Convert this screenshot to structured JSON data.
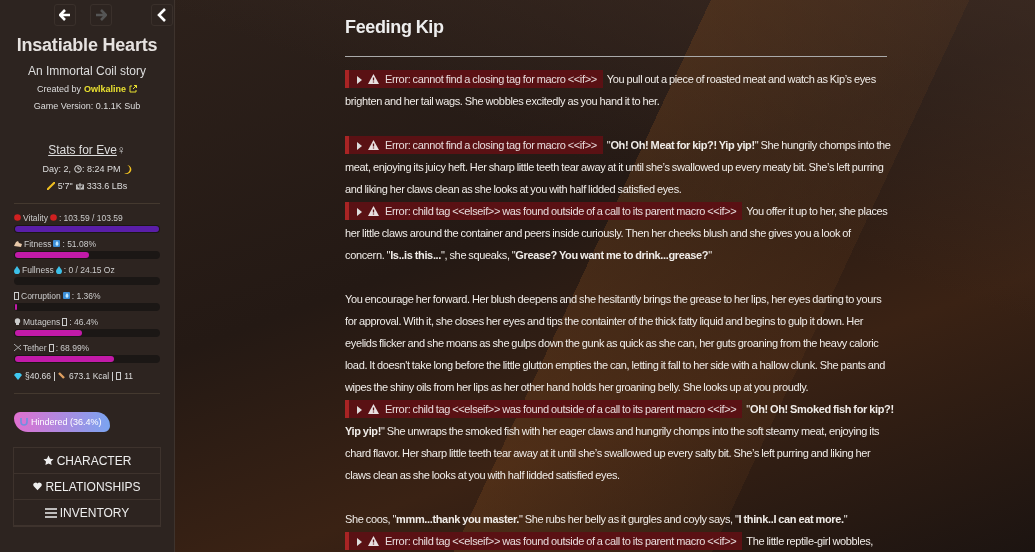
{
  "nav": {
    "back": {
      "disabled": false
    },
    "forward": {
      "disabled": true
    }
  },
  "sidebar": {
    "title": "Insatiable Hearts",
    "subtitle": "An Immortal Coil story",
    "credit_label": "Created by",
    "credit_link": "Owlkaline",
    "version": "Game Version: 0.1.1K Sub",
    "stats_link": "Stats for Eve",
    "gender_symbol": "♀",
    "time": "Day: 2,",
    "clock": ": 8:24 PM",
    "height": "5'7\"",
    "weight": "333.6 LBs",
    "stats": [
      {
        "kind": "vitality",
        "name": "Vitality",
        "value": ": 103.59 / 103.59",
        "level": 1,
        "color": "#5a1ea8"
      },
      {
        "kind": "fitness",
        "name": "Fitness",
        "value": ": 51.08%",
        "level": 0.5108,
        "color": "#c21aa8"
      },
      {
        "kind": "fullness",
        "name": "Fullness",
        "value": ": 0 / 24.15 Oz"
      },
      {
        "kind": "corruption",
        "name": "Corruption",
        "value": ": 1.36%",
        "level": 0.0136,
        "color": "#c21aa8"
      },
      {
        "kind": "mutagens",
        "name": "Mutagens",
        "value": ": 46.4%",
        "level": 0.464,
        "color": "#c21aa8"
      },
      {
        "kind": "tether",
        "name": "Tether",
        "value": ": 68.99%",
        "level": 0.6899,
        "color": "#c21aa8"
      }
    ],
    "money": "§40.66",
    "calories": "673.1 Kcal",
    "count": "11",
    "status_badge": "Hindered (36.4%)",
    "menu": [
      {
        "kind": "star",
        "label": "CHARACTER"
      },
      {
        "kind": "heart",
        "label": "RELATIONSHIPS"
      },
      {
        "kind": "list",
        "label": "INVENTORY"
      }
    ]
  },
  "passage": {
    "title": "Feeding Kip",
    "paragraphs": [
      {
        "blocks": [
          {
            "error": "Error: cannot find a closing tag for macro <<if>>",
            "lead": "You pull out a piece of roasted meat and watch as Kip’s eyes",
            "text": "brighten and her tail wags. She wobbles excitedly as you hand it to her."
          }
        ]
      },
      {
        "blocks": [
          {
            "error": "Error: cannot find a closing tag for macro <<if>>",
            "lead": "\"**Oh! Oh! Meat for kip?! Yip yip!**\" She hungrily chomps into the",
            "text": "meat, enjoying its juicy heft. Her sharp little teeth tear away at it until she’s swallowed up every meaty bit. She’s left purring and liking her claws clean as she looks at you with half lidded satisfied eyes."
          },
          {
            "error": "Error: child tag <<elseif>> was found outside of a call to its parent macro <<if>>",
            "lead": "You offer it up to her, she places",
            "text": "her little claws around the container and peers inside curiously. Then her cheeks blush and she gives you a look of concern. \"**Is..is this...**\", she squeaks, \"**Grease? You want me to drink...grease?**\""
          }
        ]
      },
      {
        "blocks": [
          {
            "text": "You encourage her forward. Her blush deepens and she hesitantly brings the grease to her lips, her eyes darting to yours for approval. With it, she closes her eyes and tips the containter of the thick fatty liquid and begins to gulp it down. Her eyelids flicker and she moans as she gulps down the gunk as quick as she can, her guts groaning from the heavy caloric load. It doesn't take long before the little glutton empties the can, letting it fall to her side with a hallow clunk. She pants and wipes the shiny oils from her lips as her other hand holds her groaning belly. She looks up at you proudly."
          },
          {
            "error": "Error: child tag <<elseif>> was found outside of a call to its parent macro <<if>>",
            "lead": "\"**Oh! Oh! Smoked fish for kip?!**",
            "text": "**Yip yip!**\" She unwraps the smoked fish with her eager claws and hungrily chomps into the soft steamy meat, enjoying its chard flavor. Her sharp little teeth tear away at it until she’s swallowed up every salty bit. She’s left purring and liking her claws clean as she looks at you with half lidded satisfied eyes."
          }
        ]
      },
      {
        "blocks": [
          {
            "text": "She coos, \"**mmm...thank you master.**\" She rubs her belly as it gurgles and coyly says, \"**I think..I can eat more.**\""
          },
          {
            "error": "Error: child tag <<elseif>> was found outside of a call to its parent macro <<if>>",
            "lead": "The little reptile-girl wobbles,"
          }
        ]
      }
    ]
  }
}
